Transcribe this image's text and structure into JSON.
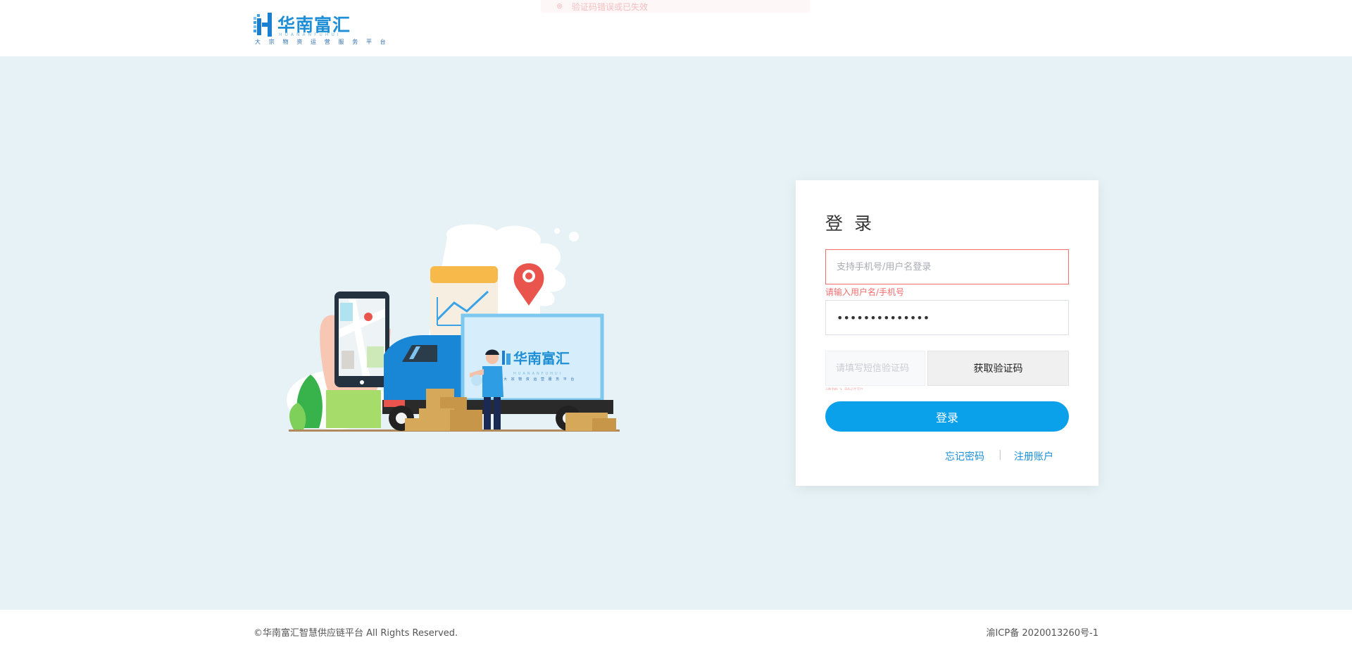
{
  "header": {
    "logo": {
      "name": "华南富汇",
      "pinyin": "HUANANFUHUI",
      "tagline": "大 宗 物 资 运 营 服 务 平 台"
    },
    "toast": {
      "icon": "error-circle-icon",
      "text": "验证码错误或已失效"
    }
  },
  "illustration": {
    "truck_logo": "华南富汇",
    "truck_pinyin": "HUANANFUHUI",
    "truck_tagline": "大 宗 物 资 运 营 服 务 平 台"
  },
  "login": {
    "title": "登 录",
    "username_placeholder": "支持手机号/用户名登录",
    "username_error": "请输入用户名/手机号",
    "password_value": "••••••••••••••",
    "code_placeholder": "请填写短信验证码",
    "code_error": "请输入验证码",
    "get_code_label": "获取验证码",
    "submit_label": "登录",
    "forgot_label": "忘记密码",
    "separator": "|",
    "register_label": "注册账户"
  },
  "footer": {
    "copyright": "©华南富汇智慧供应链平台 All Rights Reserved.",
    "icp": "渝ICP备 2020013260号-1"
  },
  "colors": {
    "background": "#e6f2f5",
    "primary": "#0aa0ea",
    "error": "#f56c6c",
    "link": "#1a8fd8"
  }
}
